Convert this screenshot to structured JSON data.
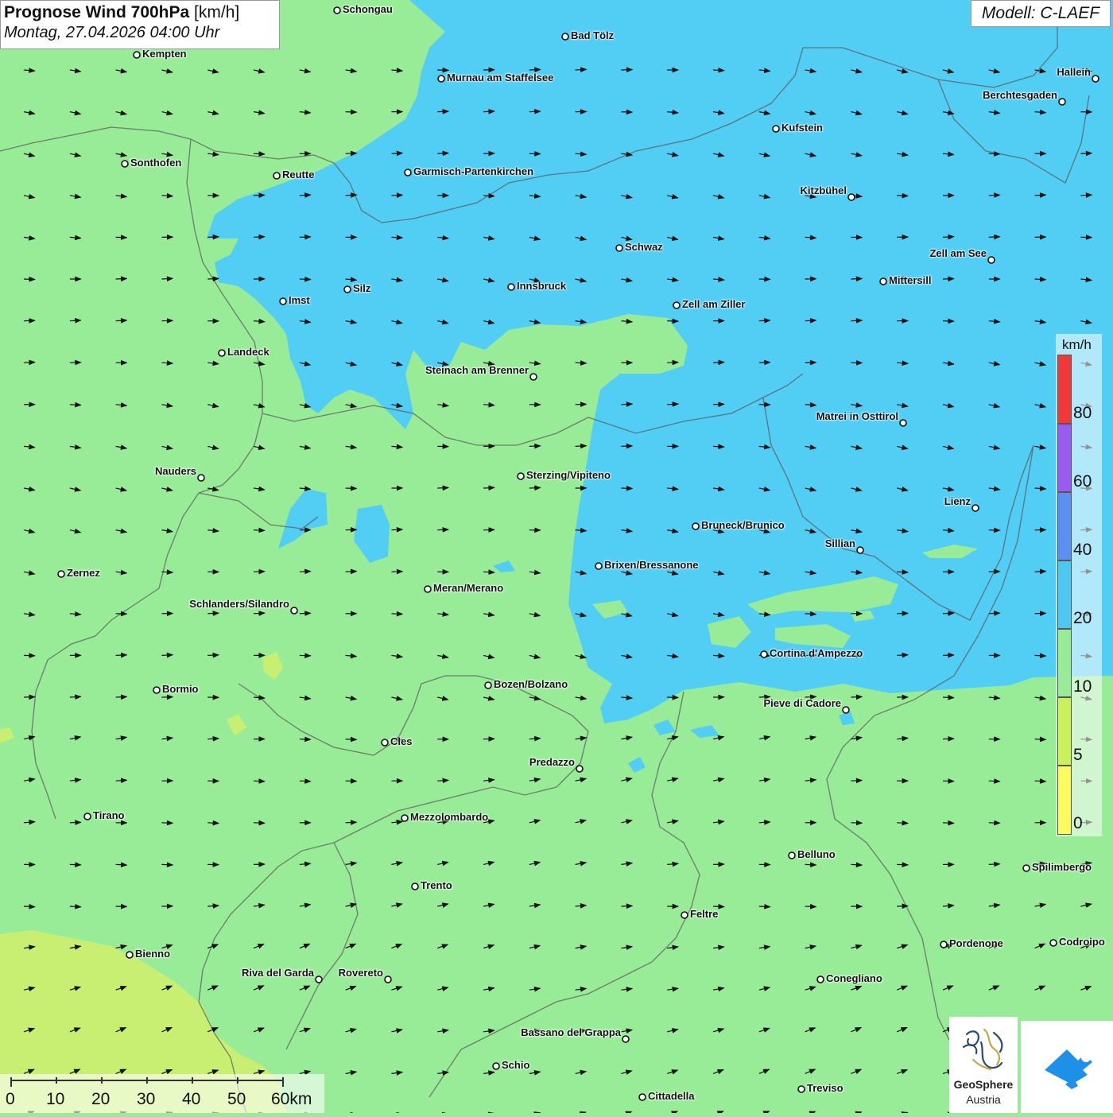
{
  "header": {
    "title": "Prognose Wind 700hPa",
    "title_unit": "[km/h]",
    "datetime": "Montag, 27.04.2026 04:00 Uhr",
    "model": "Modell: C-LAEF"
  },
  "legend": {
    "unit": "km/h",
    "ticks": [
      "0",
      "5",
      "10",
      "20",
      "40",
      "60",
      "80"
    ],
    "colors": [
      "#fbfb5e",
      "#c9f25a",
      "#98ec98",
      "#4cc8f2",
      "#5c90f0",
      "#9a5cf0",
      "#f03a3a"
    ]
  },
  "scale": {
    "labels": [
      "0",
      "10",
      "20",
      "30",
      "40",
      "50",
      "60km"
    ]
  },
  "logos": {
    "geosphere_line1": "GeoSphere",
    "geosphere_line2": "Austria",
    "app_icon": "geosphere-app-icon"
  },
  "cities": [
    {
      "name": "Schongau"
    },
    {
      "name": "Bad Tölz"
    },
    {
      "name": "Kempten"
    },
    {
      "name": "Murnau am Staffelsee"
    },
    {
      "name": "Hallein"
    },
    {
      "name": "Berchtesgaden"
    },
    {
      "name": "Kufstein"
    },
    {
      "name": "Sonthofen"
    },
    {
      "name": "Reutte"
    },
    {
      "name": "Garmisch-Partenkirchen"
    },
    {
      "name": "Kitzbühel"
    },
    {
      "name": "Schwaz"
    },
    {
      "name": "Zell am See"
    },
    {
      "name": "Mittersill"
    },
    {
      "name": "Innsbruck"
    },
    {
      "name": "Silz"
    },
    {
      "name": "Imst"
    },
    {
      "name": "Zell am Ziller"
    },
    {
      "name": "Landeck"
    },
    {
      "name": "Steinach am Brenner"
    },
    {
      "name": "Matrei in Osttirol"
    },
    {
      "name": "Nauders"
    },
    {
      "name": "Sterzing/Vipiteno"
    },
    {
      "name": "Lienz"
    },
    {
      "name": "Bruneck/Brunico"
    },
    {
      "name": "Sillian"
    },
    {
      "name": "Brixen/Bressanone"
    },
    {
      "name": "Zernez"
    },
    {
      "name": "Meran/Merano"
    },
    {
      "name": "Schlanders/Silandro"
    },
    {
      "name": "Cortina d'Ampezzo"
    },
    {
      "name": "Bozen/Bolzano"
    },
    {
      "name": "Bormio"
    },
    {
      "name": "Pieve di Cadore"
    },
    {
      "name": "Cles"
    },
    {
      "name": "Predazzo"
    },
    {
      "name": "Tirano"
    },
    {
      "name": "Mezzolombardo"
    },
    {
      "name": "Belluno"
    },
    {
      "name": "Spilimbergo"
    },
    {
      "name": "Trento"
    },
    {
      "name": "Feltre"
    },
    {
      "name": "Pordenone"
    },
    {
      "name": "Codroipo"
    },
    {
      "name": "Bienno"
    },
    {
      "name": "Riva del Garda"
    },
    {
      "name": "Rovereto"
    },
    {
      "name": "Conegliano"
    },
    {
      "name": "Bassano del Grappa"
    },
    {
      "name": "Schio"
    },
    {
      "name": "Treviso"
    },
    {
      "name": "Cittadella"
    }
  ]
}
